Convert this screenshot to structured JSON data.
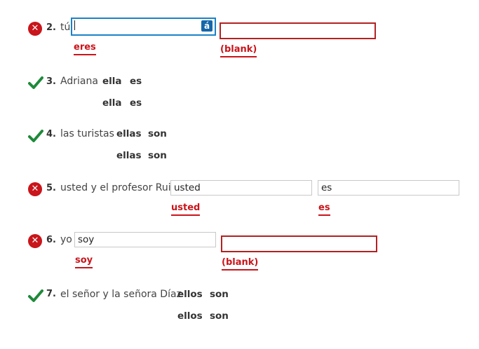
{
  "items": [
    {
      "number": "2.",
      "subject": "tú",
      "status": "incorrect",
      "answer_pronoun": "",
      "answer_verb": "",
      "correct_pronoun": "eres",
      "correct_verb": "(blank)",
      "accent_button": "á"
    },
    {
      "number": "3.",
      "subject": "Adriana",
      "status": "correct",
      "answer_pronoun": "ella",
      "answer_verb": "es",
      "correct_pronoun": "ella",
      "correct_verb": "es"
    },
    {
      "number": "4.",
      "subject": "las turistas",
      "status": "correct",
      "answer_pronoun": "ellas",
      "answer_verb": "son",
      "correct_pronoun": "ellas",
      "correct_verb": "son"
    },
    {
      "number": "5.",
      "subject": "usted y el profesor Ruiz",
      "status": "incorrect",
      "answer_pronoun": "usted",
      "answer_verb": "es",
      "correct_pronoun": "usted",
      "correct_verb": "es"
    },
    {
      "number": "6.",
      "subject": "yo",
      "status": "incorrect",
      "answer_pronoun": "soy",
      "answer_verb": "",
      "correct_pronoun": "soy",
      "correct_verb": "(blank)"
    },
    {
      "number": "7.",
      "subject": "el señor y la señora Díaz",
      "status": "correct",
      "answer_pronoun": "ellos",
      "answer_verb": "son",
      "correct_pronoun": "ellos",
      "correct_verb": "son"
    }
  ],
  "colors": {
    "correct": "#1e8a3a",
    "incorrect": "#c9151b",
    "focus": "#1a82c8"
  },
  "icons": {
    "incorrect": "x-circle-icon",
    "correct": "checkmark-icon"
  }
}
